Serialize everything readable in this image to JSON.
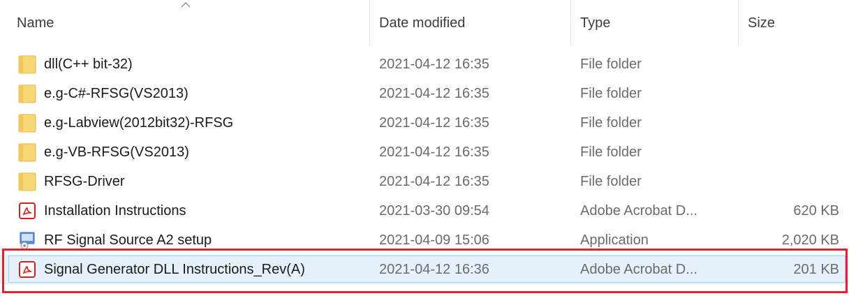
{
  "columns": {
    "name": "Name",
    "date": "Date modified",
    "type": "Type",
    "size": "Size"
  },
  "sort": {
    "column": "name",
    "direction": "ascending",
    "icon": "chevron-up-icon"
  },
  "files": [
    {
      "name": "dll(C++ bit-32)",
      "date": "2021-04-12 16:35",
      "type": "File folder",
      "size": "",
      "icon": "folder-icon"
    },
    {
      "name": "e.g-C#-RFSG(VS2013)",
      "date": "2021-04-12 16:35",
      "type": "File folder",
      "size": "",
      "icon": "folder-icon"
    },
    {
      "name": "e.g-Labview(2012bit32)-RFSG",
      "date": "2021-04-12 16:35",
      "type": "File folder",
      "size": "",
      "icon": "folder-icon"
    },
    {
      "name": "e.g-VB-RFSG(VS2013)",
      "date": "2021-04-12 16:35",
      "type": "File folder",
      "size": "",
      "icon": "folder-icon"
    },
    {
      "name": "RFSG-Driver",
      "date": "2021-04-12 16:35",
      "type": "File folder",
      "size": "",
      "icon": "folder-icon"
    },
    {
      "name": "Installation Instructions",
      "date": "2021-03-30 09:54",
      "type": "Adobe Acrobat D...",
      "size": "620 KB",
      "icon": "pdf-icon"
    },
    {
      "name": "RF Signal Source A2 setup",
      "date": "2021-04-09 15:06",
      "type": "Application",
      "size": "2,020 KB",
      "icon": "installer-icon"
    },
    {
      "name": "Signal Generator DLL Instructions_Rev(A)",
      "date": "2021-04-12 16:36",
      "type": "Adobe Acrobat D...",
      "size": "201 KB",
      "icon": "pdf-icon",
      "selected": true
    }
  ],
  "colors": {
    "folder": "#f8d775",
    "pdf": "#e02020",
    "selection_bg": "#e5f1fb",
    "selection_border": "#99d1ff",
    "highlight_box": "#e8202c"
  }
}
